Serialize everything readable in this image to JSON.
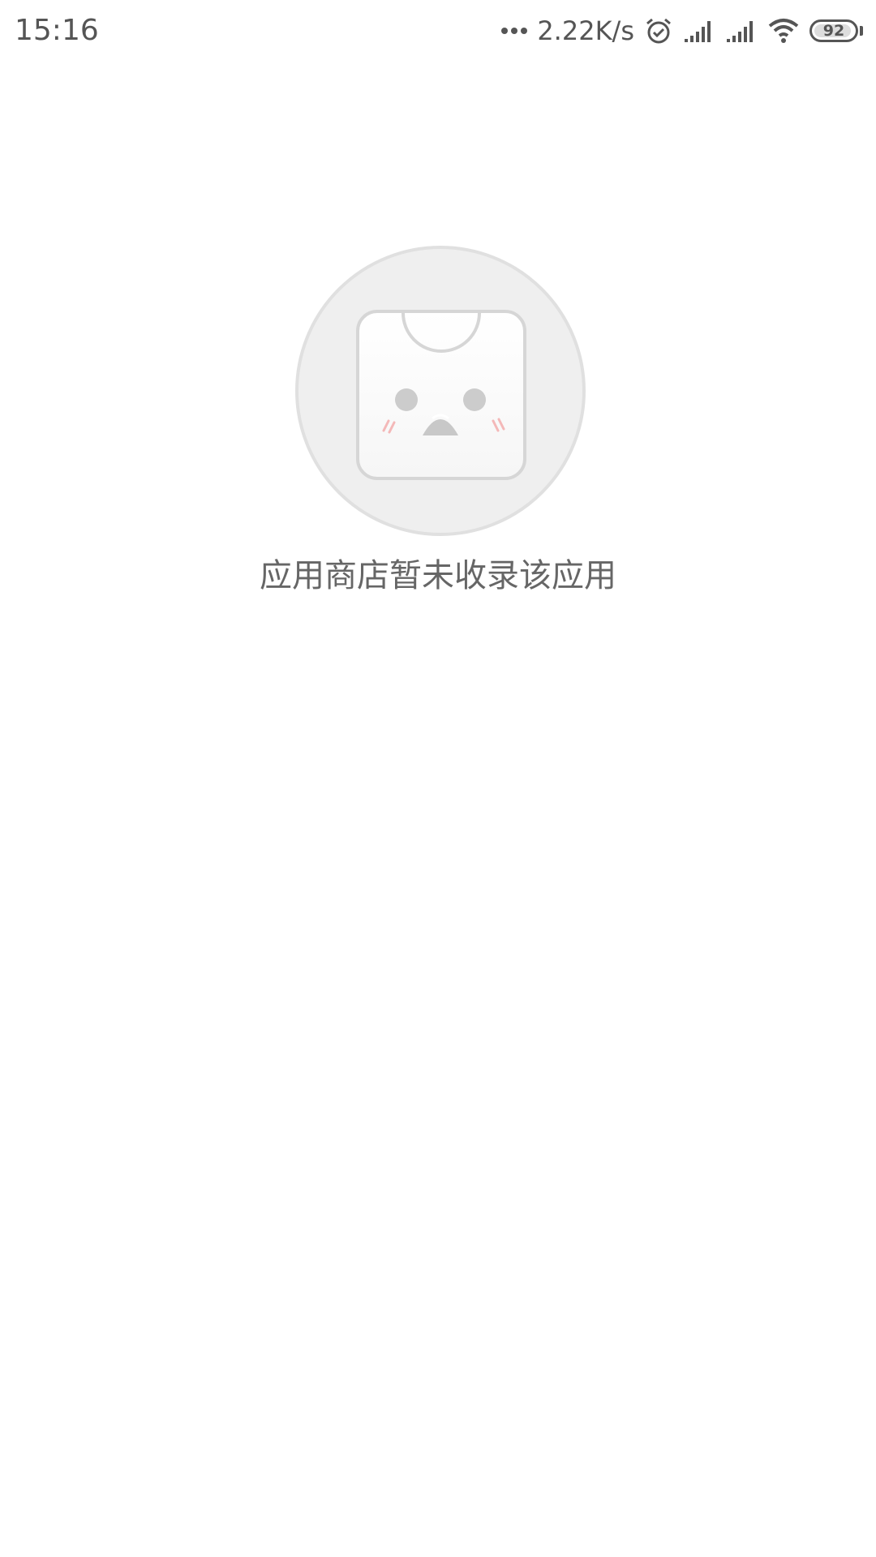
{
  "status_bar": {
    "time": "15:16",
    "network_speed": "2.22K/s",
    "battery_level": "92",
    "icons": [
      "more-dots-icon",
      "alarm-icon",
      "signal-icon",
      "signal-icon",
      "wifi-icon",
      "battery-icon"
    ]
  },
  "empty_state": {
    "illustration_icon": "sad-app-store-bag-icon",
    "message": "应用商店暂未收录该应用"
  }
}
